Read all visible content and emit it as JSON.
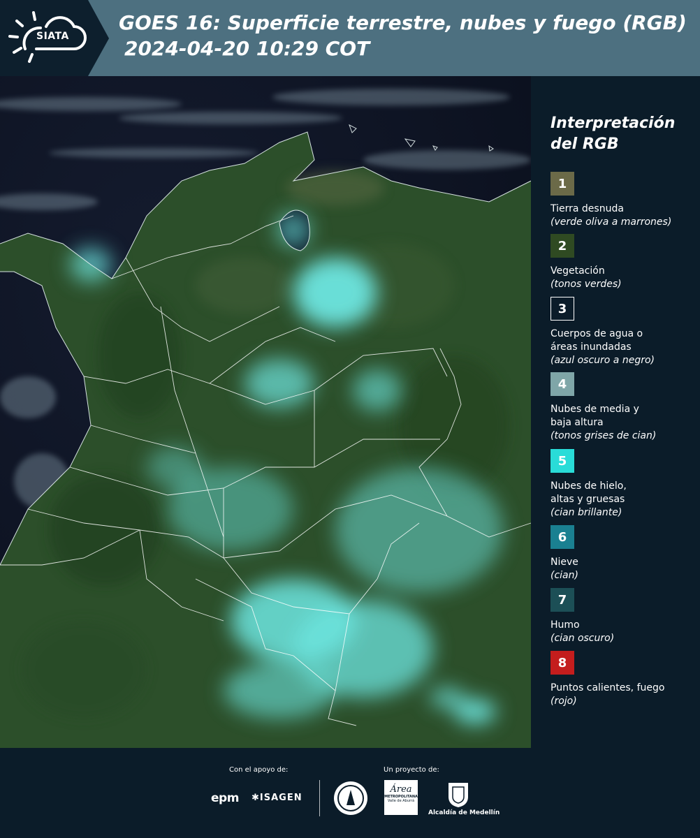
{
  "header": {
    "logo_text": "SIATA",
    "title_line1": "GOES 16: Superficie terrestre, nubes y fuego (RGB)",
    "title_line2": "2024-04-20 10:29 COT"
  },
  "map": {
    "description_icon": "satellite-rgb-composite"
  },
  "legend": {
    "title_line1": "Interpretación",
    "title_line2": "del RGB",
    "items": [
      {
        "number": "1",
        "label": "Tierra desnuda",
        "note": "(verde oliva a marrones)",
        "color": "#6b6a48"
      },
      {
        "number": "2",
        "label": "Vegetación",
        "note": "(tonos verdes)",
        "color": "#2f4a22"
      },
      {
        "number": "3",
        "label": "Cuerpos de agua o áreas inundadas",
        "note": "(azul oscuro a negro)",
        "color": "#0b1c29"
      },
      {
        "number": "4",
        "label": "Nubes de media y baja altura",
        "note": "(tonos grises de cian)",
        "color": "#7fa6a8"
      },
      {
        "number": "5",
        "label": "Nubes de hielo, altas y gruesas",
        "note": "(cian brillante)",
        "color": "#29dcd8"
      },
      {
        "number": "6",
        "label": "Nieve",
        "note": "(cian)",
        "color": "#1a8091"
      },
      {
        "number": "7",
        "label": "Humo",
        "note": "(cian oscuro)",
        "color": "#1c4f56"
      },
      {
        "number": "8",
        "label": "Puntos calientes, fuego",
        "note": "(rojo)",
        "color": "#c41d1d"
      }
    ]
  },
  "footer": {
    "support_label": "Con el apoyo de:",
    "project_label": "Un proyecto de:",
    "epm": "epm",
    "isagen": "ISAGEN",
    "metro_line1": "Área",
    "metro_line2": "METROPOLITANA",
    "metro_line3": "Valle de Aburrá",
    "medellin": "Alcaldía de Medellín"
  }
}
